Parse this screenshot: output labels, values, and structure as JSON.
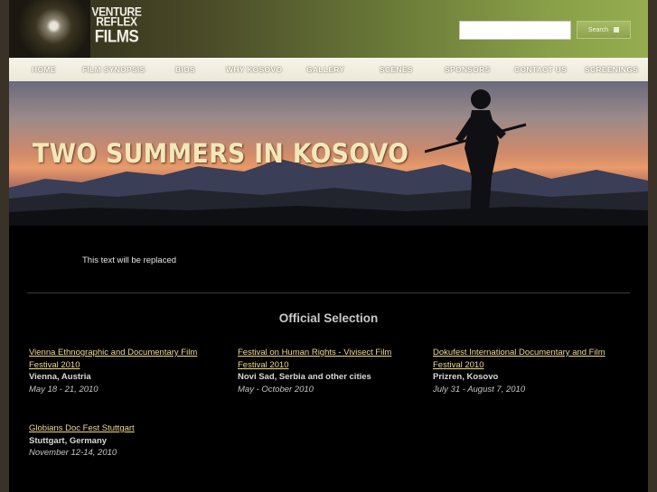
{
  "header": {
    "logo": {
      "line1": "VENTURE",
      "line2": "REFLEX",
      "line3": "FILMS"
    },
    "search": {
      "input_value": "",
      "button_label": "Search"
    }
  },
  "nav": {
    "items": [
      {
        "label": "HOME"
      },
      {
        "label": "FILM SYNOPSIS"
      },
      {
        "label": "BIOS"
      },
      {
        "label": "WHY KOSOVO"
      },
      {
        "label": "GALLERY"
      },
      {
        "label": "SCENES"
      },
      {
        "label": "SPONSORS"
      },
      {
        "label": "CONTACT US"
      },
      {
        "label": "SCREENINGS"
      }
    ]
  },
  "banner": {
    "title": "TWO SUMMERS IN KOSOVO"
  },
  "content": {
    "placeholder": "This text will be replaced",
    "heading": "Official Selection",
    "festivals": [
      {
        "name": "Vienna Ethnographic and Documentary Film Festival 2010",
        "place": "Vienna, Austria",
        "dates": "May 18 - 21, 2010"
      },
      {
        "name": "Festival on Human Rights - Vivisect Film Festival 2010",
        "place": "Novi Sad, Serbia and other cities",
        "dates": "May - October 2010"
      },
      {
        "name": "Dokufest International Documentary and Film Festival 2010",
        "place": "Prizren, Kosovo",
        "dates": "July 31 - August 7, 2010"
      },
      {
        "name": "Globians Doc Fest Stuttgart",
        "place": "Stuttgart, Germany",
        "dates": "November 12-14, 2010"
      }
    ]
  }
}
